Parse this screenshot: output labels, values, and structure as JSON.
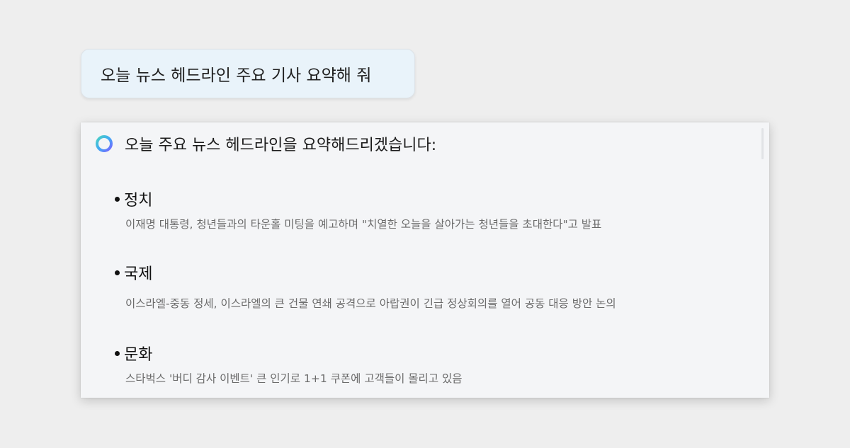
{
  "user_message": "오늘 뉴스 헤드라인 주요 기사 요약해 줘",
  "assistant": {
    "intro": "오늘 주요 뉴스 헤드라인을 요약해드리겠습니다:",
    "icon": "ai-spinner-icon",
    "sections": [
      {
        "title": "정치",
        "body": "이재명 대통령, 청년들과의 타운홀 미팅을 예고하며 \"치열한 오늘을 살아가는 청년들을 초대한다\"고 발표"
      },
      {
        "title": "국제",
        "body": "이스라엘-중동 정세, 이스라엘의 큰 건물 연쇄 공격으로 아랍권이 긴급 정상회의를 열어 공동 대응 방안 논의"
      },
      {
        "title": "문화",
        "body": "스타벅스 '버디 감사 이벤트' 큰 인기로 1+1 쿠폰에 고객들이 몰리고 있음"
      }
    ]
  },
  "colors": {
    "background": "#eeeeee",
    "user_bubble": "#e9f3fa",
    "card": "#f4f5f7",
    "icon_gradient": [
      "#3fa9f5",
      "#7b61ff",
      "#4cd3c2"
    ]
  }
}
